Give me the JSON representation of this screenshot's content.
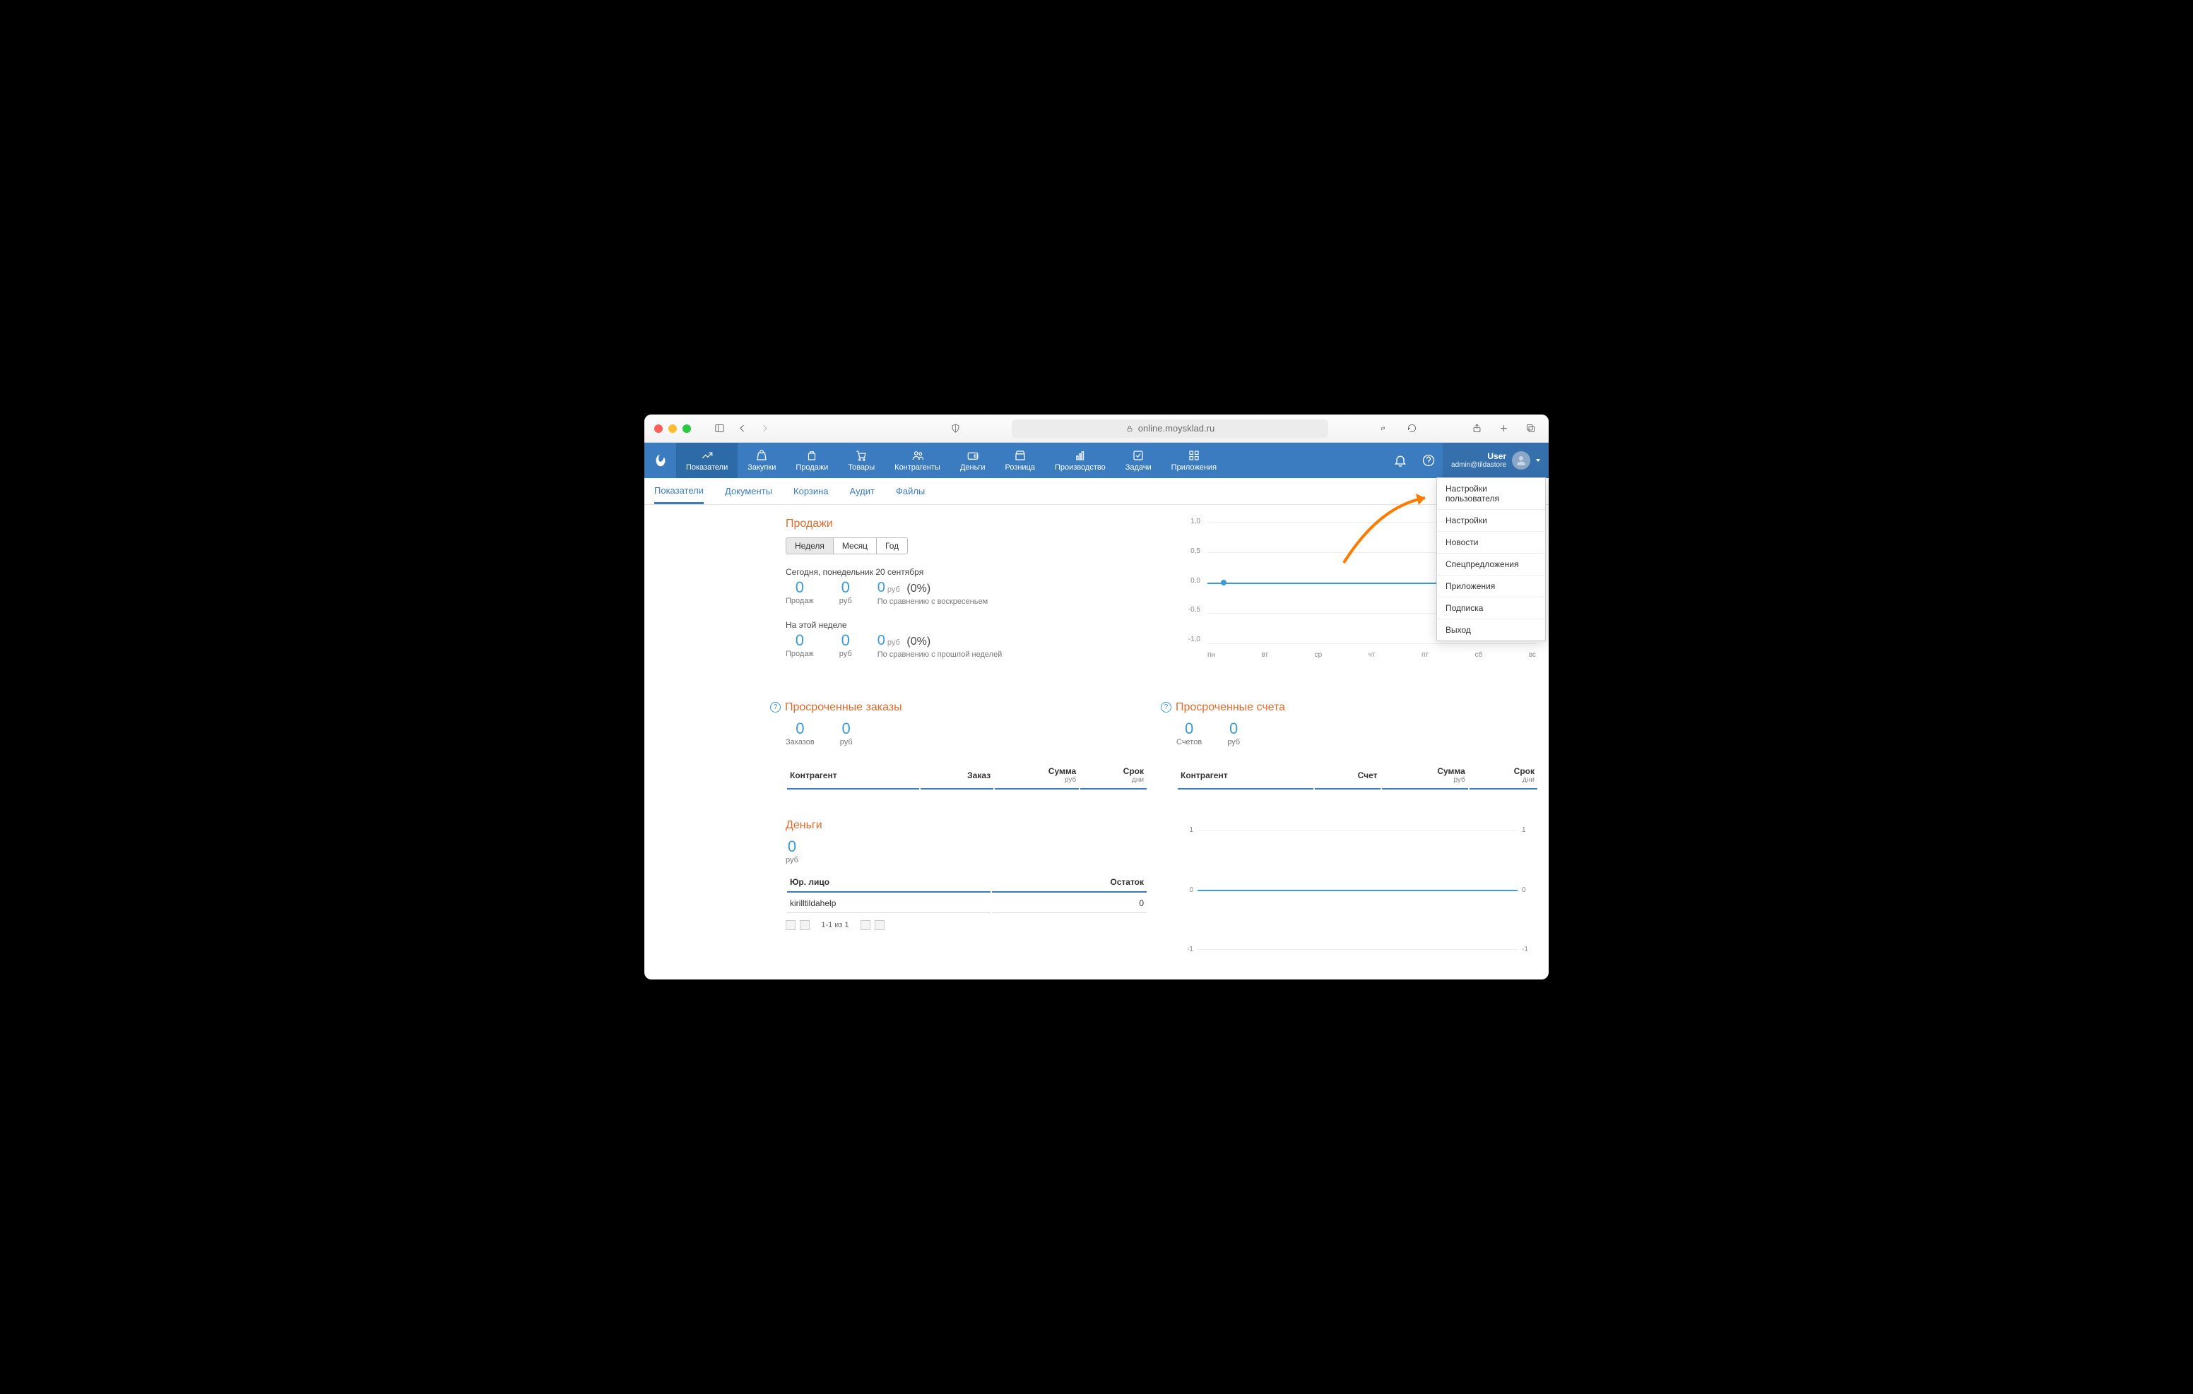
{
  "browser": {
    "url": "online.moysklad.ru"
  },
  "topnav": {
    "items": [
      {
        "label": "Показатели"
      },
      {
        "label": "Закупки"
      },
      {
        "label": "Продажи"
      },
      {
        "label": "Товары"
      },
      {
        "label": "Контрагенты"
      },
      {
        "label": "Деньги"
      },
      {
        "label": "Розница"
      },
      {
        "label": "Производство"
      },
      {
        "label": "Задачи"
      },
      {
        "label": "Приложения"
      }
    ],
    "user": {
      "name": "User",
      "email": "admin@tildastore"
    }
  },
  "subnav": {
    "items": [
      {
        "label": "Показатели"
      },
      {
        "label": "Документы"
      },
      {
        "label": "Корзина"
      },
      {
        "label": "Аудит"
      },
      {
        "label": "Файлы"
      }
    ]
  },
  "dropdown": {
    "items": [
      "Настройки пользователя",
      "Настройки",
      "Новости",
      "Спецпредложения",
      "Приложения",
      "Подписка",
      "Выход"
    ]
  },
  "sales": {
    "title": "Продажи",
    "tabs": {
      "week": "Неделя",
      "month": "Месяц",
      "year": "Год"
    },
    "today_label": "Сегодня, понедельник 20 сентября",
    "today": {
      "sales_n": "0",
      "sales_l": "Продаж",
      "rub_n": "0",
      "rub_l": "руб",
      "amt": "0",
      "cur": "руб",
      "pct": "(0%)",
      "compare": "По сравнению с воскресеньем"
    },
    "week_label": "На этой неделе",
    "week": {
      "sales_n": "0",
      "sales_l": "Продаж",
      "rub_n": "0",
      "rub_l": "руб",
      "amt": "0",
      "cur": "руб",
      "pct": "(0%)",
      "compare": "По сравнению с прошлой неделей"
    }
  },
  "overdue_orders": {
    "title": "Просроченные заказы",
    "orders_n": "0",
    "orders_l": "Заказов",
    "rub_n": "0",
    "rub_l": "руб",
    "cols": {
      "c1": "Контрагент",
      "c2": "Заказ",
      "c3": "Сумма",
      "c3s": "руб",
      "c4": "Срок",
      "c4s": "дни"
    }
  },
  "overdue_invoices": {
    "title": "Просроченные счета",
    "inv_n": "0",
    "inv_l": "Счетов",
    "rub_n": "0",
    "rub_l": "руб",
    "cols": {
      "c1": "Контрагент",
      "c2": "Счет",
      "c3": "Сумма",
      "c3s": "руб",
      "c4": "Срок",
      "c4s": "дни"
    }
  },
  "money": {
    "title": "Деньги",
    "total_n": "0",
    "total_l": "руб",
    "cols": {
      "c1": "Юр. лицо",
      "c2": "Остаток"
    },
    "rows": [
      {
        "name": "kirilltildahelp",
        "balance": "0"
      }
    ],
    "pager": "1-1 из 1"
  },
  "chart_data": {
    "type": "line",
    "categories": [
      "пн",
      "вт",
      "ср",
      "чт",
      "пт",
      "сб",
      "вс"
    ],
    "values": [
      0,
      0,
      0,
      0,
      0,
      0,
      0
    ],
    "ylim": [
      -1.0,
      1.0
    ],
    "yticks": [
      "1,0",
      "0,5",
      "0,0",
      "-0,5",
      "-1,0"
    ]
  },
  "chart_data_money": {
    "type": "line",
    "values": [
      0,
      0
    ],
    "ylim": [
      -1,
      1
    ],
    "yticks": [
      "1",
      "0",
      "-1"
    ]
  }
}
